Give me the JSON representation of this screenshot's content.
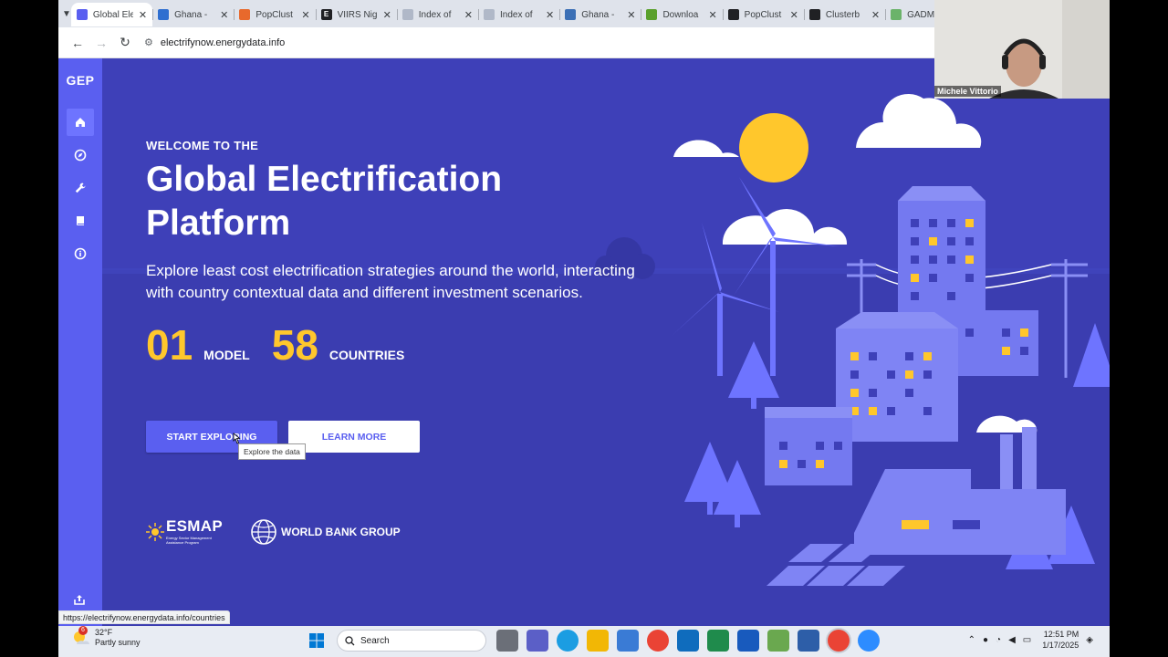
{
  "browser": {
    "tabs": [
      {
        "title": "Global Ele",
        "favicon_color": "#5a5ff0",
        "active": true
      },
      {
        "title": "Ghana -",
        "favicon_color": "#2f6fd0"
      },
      {
        "title": "PopClust",
        "favicon_color": "#e8692c"
      },
      {
        "title": "VIIRS Nig",
        "favicon_color": "#202124",
        "favicon_letter": "E"
      },
      {
        "title": "Index of",
        "favicon_color": "#b0b8c8"
      },
      {
        "title": "Index of",
        "favicon_color": "#b0b8c8"
      },
      {
        "title": "Ghana -",
        "favicon_color": "#3b6fb5"
      },
      {
        "title": "Downloa",
        "favicon_color": "#5aa02c"
      },
      {
        "title": "PopClust",
        "favicon_color": "#202124"
      },
      {
        "title": "Clusterb",
        "favicon_color": "#202124"
      },
      {
        "title": "GADM",
        "favicon_color": "#6bb36a"
      }
    ],
    "url": "electrifynow.energydata.info",
    "close_glyph": "✕"
  },
  "sidebar": {
    "brand": "GEP",
    "items": [
      {
        "icon": "home-icon",
        "active": true
      },
      {
        "icon": "compass-icon"
      },
      {
        "icon": "wrench-icon"
      },
      {
        "icon": "book-icon"
      },
      {
        "icon": "info-icon"
      }
    ]
  },
  "hero": {
    "eyebrow": "WELCOME TO THE",
    "title_line1": "Global Electrification",
    "title_line2": "Platform",
    "lead": "Explore least cost electrification strategies around the world, interacting with country contextual data and different investment scenarios.",
    "stats": [
      {
        "value": "01",
        "label": "MODEL"
      },
      {
        "value": "58",
        "label": "COUNTRIES"
      }
    ],
    "primary_button": "START EXPLORING",
    "secondary_button": "LEARN MORE",
    "tooltip": "Explore the data"
  },
  "partners": {
    "esmap": "ESMAP",
    "esmap_sub": "Energy Sector Management Assistance Program",
    "world_bank": "WORLD BANK GROUP"
  },
  "webcam": {
    "name": "Michele Vittorio"
  },
  "status_link": "https://electrifynow.energydata.info/countries",
  "taskbar": {
    "weather_badge": "6",
    "temperature": "32°F",
    "condition": "Partly sunny",
    "search_placeholder": "Search",
    "time": "12:51 PM",
    "date": "1/17/2025"
  },
  "colors": {
    "page_bg": "#3e40b8",
    "sidebar": "#5a5ff0",
    "accent_yellow": "#ffc72c",
    "buildings": "#7479f0"
  }
}
